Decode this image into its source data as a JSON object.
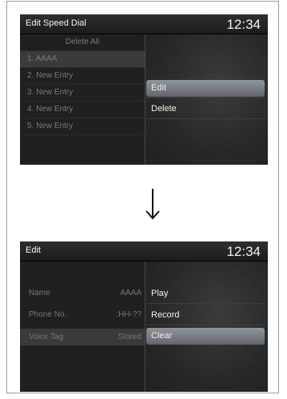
{
  "top_screen": {
    "title": "Edit Speed Dial",
    "clock": "12:34",
    "list": [
      {
        "label": "Delete All"
      },
      {
        "label": "1. AAAA"
      },
      {
        "label": "2. New Entry"
      },
      {
        "label": "3. New Entry"
      },
      {
        "label": "4. New Entry"
      },
      {
        "label": "5. New Entry"
      }
    ],
    "menu": [
      {
        "label": "Edit"
      },
      {
        "label": "Delete"
      }
    ]
  },
  "bottom_screen": {
    "title": "Edit",
    "clock": "12:34",
    "fields": [
      {
        "label": "Name",
        "value": "AAAA"
      },
      {
        "label": "Phone No.",
        "value": ":HH-??"
      },
      {
        "label": "Voice Tag",
        "value": "Stored"
      }
    ],
    "menu": [
      {
        "label": "Play"
      },
      {
        "label": "Record"
      },
      {
        "label": "Clear"
      }
    ]
  },
  "arrow_icon": "down-arrow-icon"
}
